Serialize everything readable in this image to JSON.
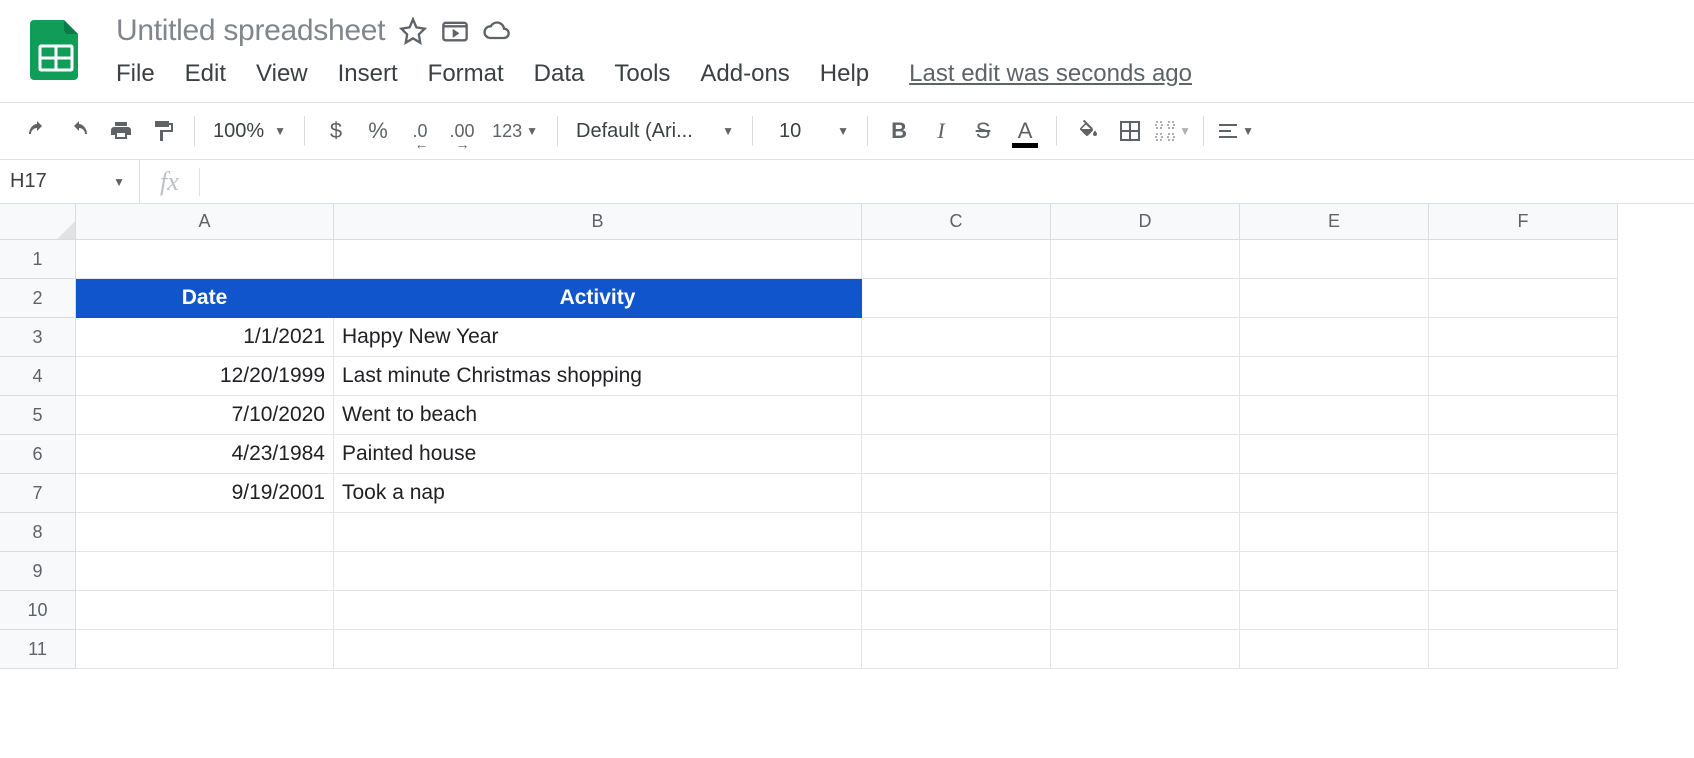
{
  "doc": {
    "title": "Untitled spreadsheet",
    "last_edit": "Last edit was seconds ago"
  },
  "menu": {
    "file": "File",
    "edit": "Edit",
    "view": "View",
    "insert": "Insert",
    "format": "Format",
    "data": "Data",
    "tools": "Tools",
    "addons": "Add-ons",
    "help": "Help"
  },
  "toolbar": {
    "zoom": "100%",
    "currency": "$",
    "percent": "%",
    "dec_decrease": ".0",
    "dec_increase": ".00",
    "more_formats": "123",
    "font": "Default (Ari...",
    "font_size": "10",
    "bold": "B",
    "italic": "I",
    "strike": "S",
    "text_color": "A"
  },
  "namebox": "H17",
  "columns": [
    "A",
    "B",
    "C",
    "D",
    "E",
    "F"
  ],
  "rows": [
    "1",
    "2",
    "3",
    "4",
    "5",
    "6",
    "7",
    "8",
    "9",
    "10",
    "11"
  ],
  "sheet": {
    "headers": {
      "date": "Date",
      "activity": "Activity"
    },
    "data": [
      {
        "date": "1/1/2021",
        "activity": "Happy New Year"
      },
      {
        "date": "12/20/1999",
        "activity": "Last minute Christmas shopping"
      },
      {
        "date": "7/10/2020",
        "activity": "Went to beach"
      },
      {
        "date": "4/23/1984",
        "activity": "Painted house"
      },
      {
        "date": "9/19/2001",
        "activity": "Took a nap"
      }
    ]
  }
}
